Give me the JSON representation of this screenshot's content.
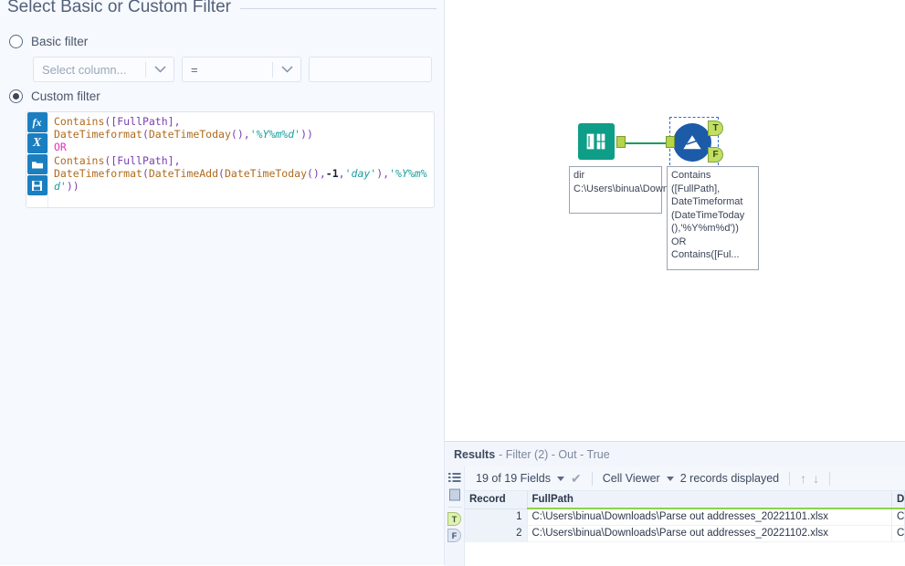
{
  "config_panel": {
    "title": "Select Basic or Custom Filter",
    "basic": {
      "radio_label": "Basic filter",
      "selected": false,
      "column_placeholder": "Select column...",
      "operator_value": "=",
      "value_text": ""
    },
    "custom": {
      "radio_label": "Custom filter",
      "selected": true,
      "gutter": [
        {
          "name": "function-icon",
          "glyph": "fx"
        },
        {
          "name": "variable-icon",
          "glyph": "X"
        },
        {
          "name": "open-folder-icon",
          "glyph": "folder"
        },
        {
          "name": "save-icon",
          "glyph": "floppy"
        }
      ],
      "expression": "Contains([FullPath],\nDateTimeformat(DateTimeToday(),'%Y%m%d'))\nOR\nContains([FullPath],\nDateTimeformat(DateTimeAdd(DateTimeToday(),-1,'day'),'%Y%m%d'))",
      "tokens": [
        {
          "t": "Contains",
          "c": "fn"
        },
        {
          "t": "(",
          "c": "punc"
        },
        {
          "t": "[FullPath]",
          "c": "field"
        },
        {
          "t": ",",
          "c": "punc"
        },
        {
          "t": "\n",
          "c": "plain"
        },
        {
          "t": "DateTimeformat",
          "c": "fn"
        },
        {
          "t": "(",
          "c": "punc"
        },
        {
          "t": "DateTimeToday",
          "c": "fn"
        },
        {
          "t": "()",
          "c": "punc"
        },
        {
          "t": ",",
          "c": "punc"
        },
        {
          "t": "'%Y%m%d'",
          "c": "str"
        },
        {
          "t": "))",
          "c": "punc"
        },
        {
          "t": "\n",
          "c": "plain"
        },
        {
          "t": "OR",
          "c": "op"
        },
        {
          "t": "\n",
          "c": "plain"
        },
        {
          "t": "Contains",
          "c": "fn"
        },
        {
          "t": "(",
          "c": "punc"
        },
        {
          "t": "[FullPath]",
          "c": "field"
        },
        {
          "t": ",",
          "c": "punc"
        },
        {
          "t": "\n",
          "c": "plain"
        },
        {
          "t": "DateTimeformat",
          "c": "fn"
        },
        {
          "t": "(",
          "c": "punc"
        },
        {
          "t": "DateTimeAdd",
          "c": "fn"
        },
        {
          "t": "(",
          "c": "punc"
        },
        {
          "t": "DateTimeToday",
          "c": "fn"
        },
        {
          "t": "()",
          "c": "punc"
        },
        {
          "t": ",",
          "c": "punc"
        },
        {
          "t": "-1",
          "c": "num"
        },
        {
          "t": ",",
          "c": "punc"
        },
        {
          "t": "'day'",
          "c": "str"
        },
        {
          "t": ")",
          "c": "punc"
        },
        {
          "t": ",",
          "c": "punc"
        },
        {
          "t": "'%Y%m%d'",
          "c": "str"
        },
        {
          "t": "))",
          "c": "punc"
        }
      ]
    }
  },
  "canvas": {
    "nodes": [
      {
        "name": "directory-tool",
        "icon": "directory-book-icon",
        "label": "dir\nC:\\Users\\binua\\Downloads\\*.xlsx",
        "selected": false
      },
      {
        "name": "filter-tool",
        "icon": "filter-funnel-icon",
        "label": "Contains ([FullPath], DateTimeformat (DateTimeToday (),'%Y%m%d')) OR Contains([Ful...",
        "selected": true,
        "outputs": [
          {
            "anchor": "T",
            "name": "true-output-anchor"
          },
          {
            "anchor": "F",
            "name": "false-output-anchor"
          }
        ]
      }
    ]
  },
  "results": {
    "title": "Results",
    "subtitle": "- Filter (2) - Out - True",
    "toolbar": {
      "fields_label": "19 of 19 Fields",
      "viewer_label": "Cell Viewer",
      "records_label": "2 records displayed"
    },
    "rail": [
      {
        "name": "field-list-icon",
        "glyph": "list"
      },
      {
        "name": "layout-panel-icon",
        "glyph": "panel"
      },
      {
        "name": "rail-anchor-true",
        "glyph": "T",
        "selected": true
      },
      {
        "name": "rail-anchor-false",
        "glyph": "F",
        "selected": false
      }
    ],
    "columns": [
      "Record",
      "FullPath",
      "D"
    ],
    "rows": [
      {
        "record": "1",
        "fullpath": "C:\\Users\\binua\\Downloads\\Parse out addresses_20221101.xlsx",
        "next": "C"
      },
      {
        "record": "2",
        "fullpath": "C:\\Users\\binua\\Downloads\\Parse out addresses_20221102.xlsx",
        "next": "C"
      }
    ]
  },
  "colors": {
    "accent_blue": "#1c5ba8",
    "directory_green": "#0e9e87",
    "anchor_green": "#b5d44a",
    "connector_green": "#1a9e5c",
    "panel_bg": "#f6f9fd",
    "header_bar_green": "#8ed14e"
  }
}
